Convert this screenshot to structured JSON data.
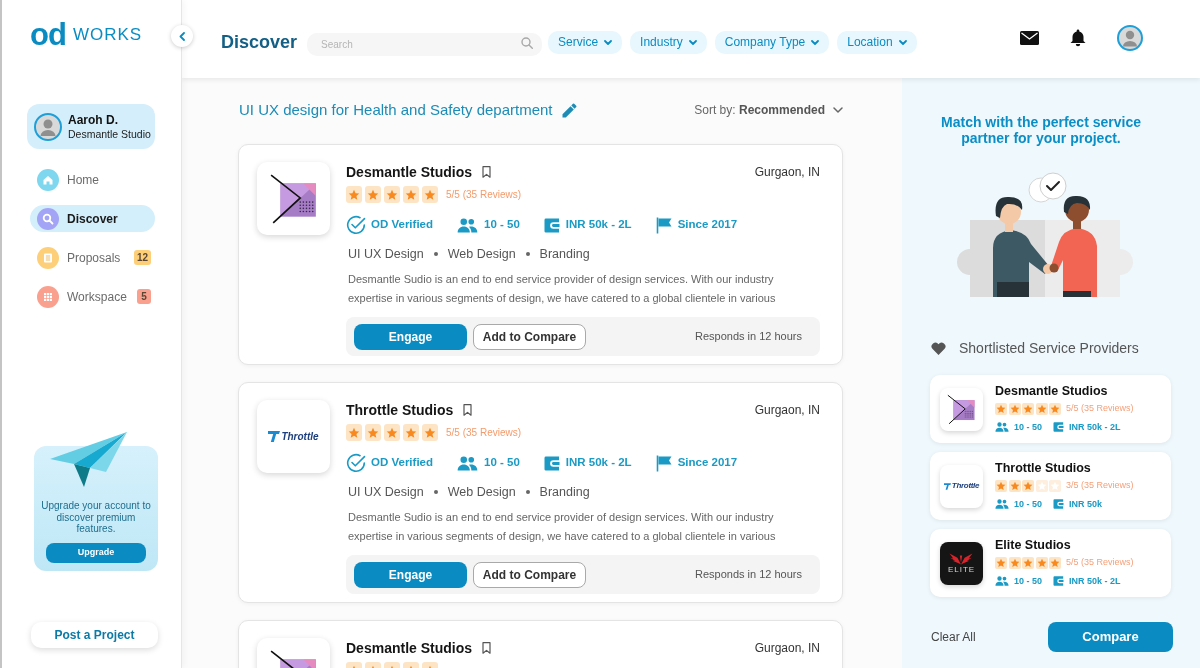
{
  "sidebar": {
    "logo": {
      "mark": "od",
      "word": "WORKS"
    },
    "profile": {
      "name": "Aaroh D.",
      "company": "Desmantle Studio"
    },
    "nav": [
      {
        "label": "Home",
        "selected": false,
        "color": "#7fd7ef"
      },
      {
        "label": "Discover",
        "selected": true,
        "color": "#a3a4f5"
      },
      {
        "label": "Proposals",
        "selected": false,
        "color": "#fdcf79",
        "badge": "12"
      },
      {
        "label": "Workspace",
        "selected": false,
        "color": "#f9a08f",
        "badge": "5"
      }
    ],
    "upgrade": {
      "text": "Upgrade your account to discover premium features.",
      "button": "Upgrade"
    },
    "post_button": "Post a Project"
  },
  "topbar": {
    "title": "Discover",
    "search": {
      "placeholder": "Search"
    },
    "filters": [
      "Service",
      "Industry",
      "Company Type",
      "Location"
    ]
  },
  "main": {
    "project_title": "UI UX design for Health and Safety department",
    "sort": {
      "label": "Sort by:",
      "value": "Recommended"
    },
    "providers": [
      {
        "logo": {
          "kind": "chevron"
        },
        "name": "Desmantle Studios",
        "location": "Gurgaon, IN",
        "stars": 5,
        "rating": "5/5 (35 Reviews)",
        "verified": "OD Verified",
        "team_size": "10 - 50",
        "budget": "INR 50k - 2L",
        "since": "Since 2017",
        "tags": [
          "UI UX Design",
          "Web Design",
          "Branding"
        ],
        "description": "Desmantle Sudio is an end to end service provider of design services. With our industry expertise in various segments of design, we have catered to a global clientele in various",
        "engage_button": "Engage",
        "compare_button": "Add to Compare",
        "response": "Responds in 12 hours"
      },
      {
        "logo": {
          "kind": "wordmark",
          "text": "Throttle"
        },
        "name": "Throttle Studios",
        "location": "Gurgaon, IN",
        "stars": 5,
        "rating": "5/5 (35 Reviews)",
        "verified": "OD Verified",
        "team_size": "10 - 50",
        "budget": "INR 50k - 2L",
        "since": "Since 2017",
        "tags": [
          "UI UX Design",
          "Web Design",
          "Branding"
        ],
        "description": "Desmantle Sudio is an end to end service provider of design services. With our industry expertise in various segments of design, we have catered to a global clientele in various",
        "engage_button": "Engage",
        "compare_button": "Add to Compare",
        "response": "Responds in 12 hours"
      },
      {
        "logo": {
          "kind": "chevron"
        },
        "name": "Desmantle Studios",
        "location": "Gurgaon, IN",
        "stars": 5
      }
    ]
  },
  "right_panel": {
    "headline": "Match with the perfect service partner for your project.",
    "shortlist_title": "Shortlisted Service Providers",
    "shortlist": [
      {
        "logo": {
          "kind": "chevron"
        },
        "name": "Desmantle Studios",
        "stars": 5,
        "rating": "5/5 (35 Reviews)",
        "team_size": "10 - 50",
        "budget": "INR 50k - 2L"
      },
      {
        "logo": {
          "kind": "wordmark",
          "text": "Throttle"
        },
        "name": "Throttle Studios",
        "stars": 3,
        "rating": "3/5 (35 Reviews)",
        "team_size": "10 - 50",
        "budget": "INR 50k"
      },
      {
        "logo": {
          "kind": "wings",
          "text": "ELITE"
        },
        "name": "Elite Studios",
        "stars": 5,
        "rating": "5/5 (35 Reviews)",
        "team_size": "10 - 50",
        "budget": "INR 50k - 2L"
      }
    ],
    "clear_button": "Clear All",
    "compare_button": "Compare"
  }
}
